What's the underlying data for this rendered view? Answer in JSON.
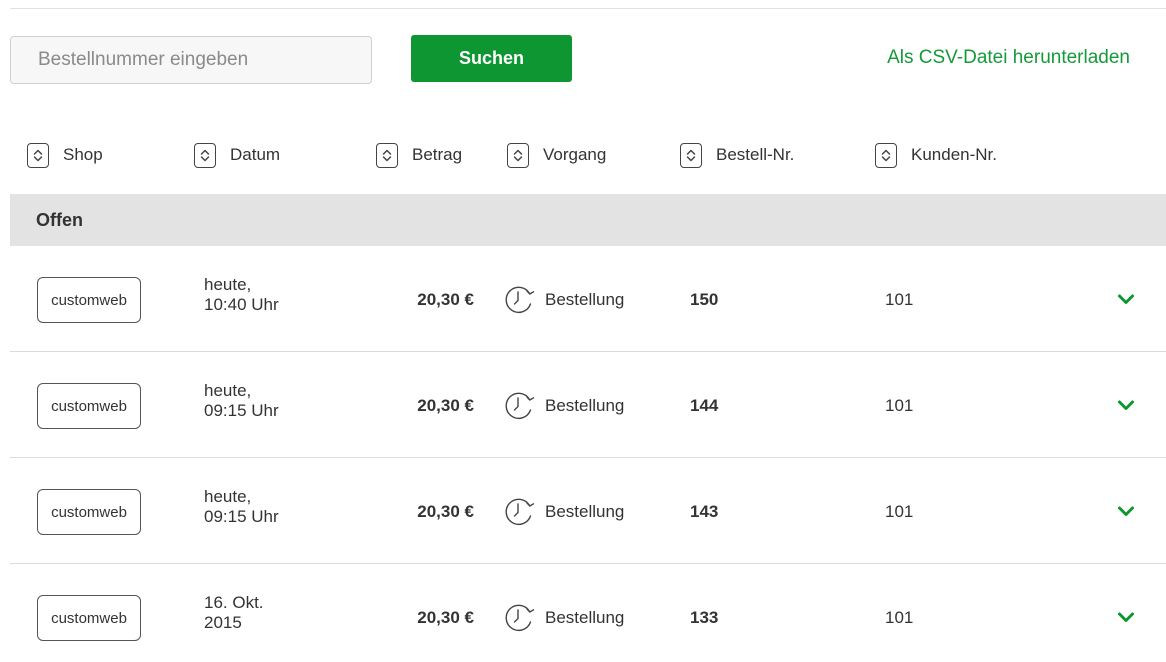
{
  "search": {
    "placeholder": "Bestellnummer eingeben",
    "value": "",
    "button_label": "Suchen"
  },
  "csv_link": "Als CSV-Datei herunterladen",
  "columns": [
    {
      "label": "Shop",
      "icon": "sort-toggle-icon"
    },
    {
      "label": "Datum",
      "icon": "sort-toggle-icon"
    },
    {
      "label": "Betrag",
      "icon": "sort-toggle-icon"
    },
    {
      "label": "Vorgang",
      "icon": "sort-toggle-icon"
    },
    {
      "label": "Bestell-Nr.",
      "icon": "sort-toggle-icon"
    },
    {
      "label": "Kunden-Nr.",
      "icon": "sort-toggle-icon"
    }
  ],
  "section": {
    "title": "Offen"
  },
  "rows": [
    {
      "shop": "customweb",
      "date_line1": "heute,",
      "date_line2": "10:40 Uhr",
      "amount": "20,30 €",
      "process": "Bestellung",
      "order_no": "150",
      "customer_no": "101"
    },
    {
      "shop": "customweb",
      "date_line1": "heute,",
      "date_line2": "09:15 Uhr",
      "amount": "20,30 €",
      "process": "Bestellung",
      "order_no": "144",
      "customer_no": "101"
    },
    {
      "shop": "customweb",
      "date_line1": "heute,",
      "date_line2": "09:15 Uhr",
      "amount": "20,30 €",
      "process": "Bestellung",
      "order_no": "143",
      "customer_no": "101"
    },
    {
      "shop": "customweb",
      "date_line1": "16. Okt.",
      "date_line2": "2015",
      "amount": "20,30 €",
      "process": "Bestellung",
      "order_no": "133",
      "customer_no": "101"
    }
  ],
  "colors": {
    "accent": "#0e9632",
    "link": "#159a3a",
    "section_bg": "#e3e3e3"
  },
  "icons": {
    "process": "clock-arrow-icon",
    "expand": "chevron-down-icon"
  }
}
